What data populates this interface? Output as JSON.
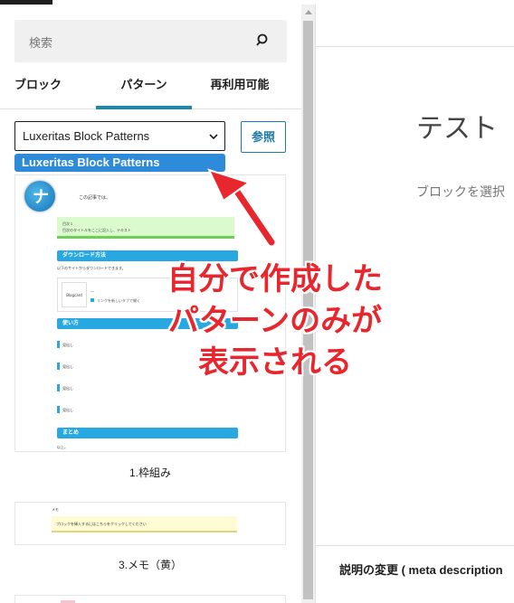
{
  "sidebar": {
    "search_placeholder": "検索",
    "tabs": [
      {
        "label": "ブロック",
        "active": false
      },
      {
        "label": "パターン",
        "active": true
      },
      {
        "label": "再利用可能",
        "active": false
      }
    ],
    "category_select": {
      "value": "Luxeritas Block Patterns"
    },
    "browse_button": "参照",
    "dropdown_option": "Luxeritas Block Patterns",
    "patterns": [
      {
        "caption": "1.枠組み",
        "preview": {
          "logo_letter": "ナ",
          "intro": "この記事では、",
          "green_line1": "目次１",
          "green_line2": "目次のタイトルをここに記入し、テキスト",
          "heading1": "ダウンロード方法",
          "text1": "以下のサイトからダウンロードできます。",
          "thumb_label": "Blogcard",
          "box_line1": "―",
          "box_line2": "リンクを新しいタブで開く",
          "heading2": "使い方",
          "items": [
            "見出し",
            "見出し",
            "見出し",
            "見出し"
          ],
          "heading3": "まとめ",
          "footer": "以上。"
        }
      },
      {
        "caption": "3.メモ（黄）",
        "preview": {
          "tag": "メモ",
          "text": "ブロックを挿入するにはこちらをクリックしてください"
        }
      },
      {
        "caption": "",
        "preview": {}
      }
    ]
  },
  "editor": {
    "title": "テスト",
    "hint": "ブロックを選択",
    "meta_label": "説明の変更 ( meta description"
  },
  "annotation": {
    "lines": [
      "自分で作成した",
      "パターンのみが",
      "表示される"
    ],
    "color": "#e8262d"
  },
  "colors": {
    "accent": "#1b8aac",
    "dropdown_highlight": "#2d8bd9",
    "link": "#1b7aa8"
  }
}
